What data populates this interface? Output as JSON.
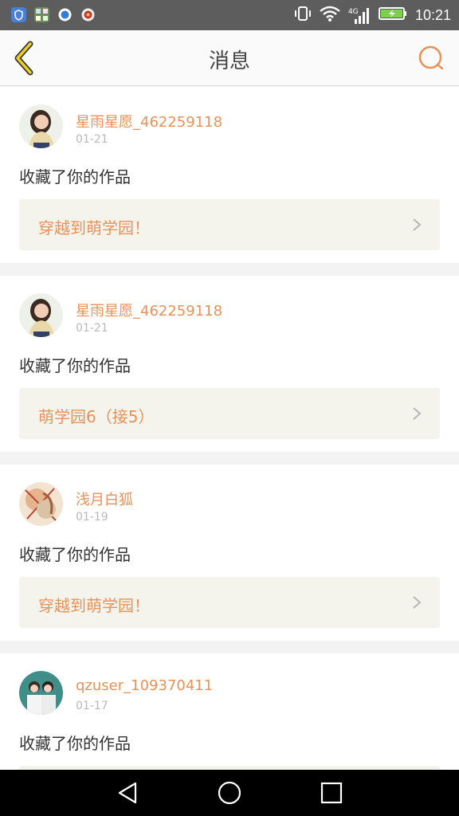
{
  "status_bar": {
    "time": "10:21",
    "network": "4G",
    "app_icons": [
      "shield-app-icon",
      "grid-app-icon",
      "browser-app-icon",
      "red-app-icon"
    ]
  },
  "header": {
    "title": "消息",
    "back_icon": "chevron-left-icon",
    "chat_icon": "chat-bubble-icon",
    "accent": "#e89159"
  },
  "messages": [
    {
      "username": "星雨星愿_462259118",
      "date": "01-21",
      "action": "收藏了你的作品",
      "work_title": "穿越到萌学园！"
    },
    {
      "username": "星雨星愿_462259118",
      "date": "01-21",
      "action": "收藏了你的作品",
      "work_title": "萌学园6（接5）"
    },
    {
      "username": "浅月白狐",
      "date": "01-19",
      "action": "收藏了你的作品",
      "work_title": "穿越到萌学园！"
    },
    {
      "username": "qzuser_109370411",
      "date": "01-17",
      "action": "收藏了你的作品",
      "work_title": ""
    }
  ],
  "nav_bar": {
    "icons": [
      "back-triangle-icon",
      "home-circle-icon",
      "recents-square-icon"
    ]
  }
}
